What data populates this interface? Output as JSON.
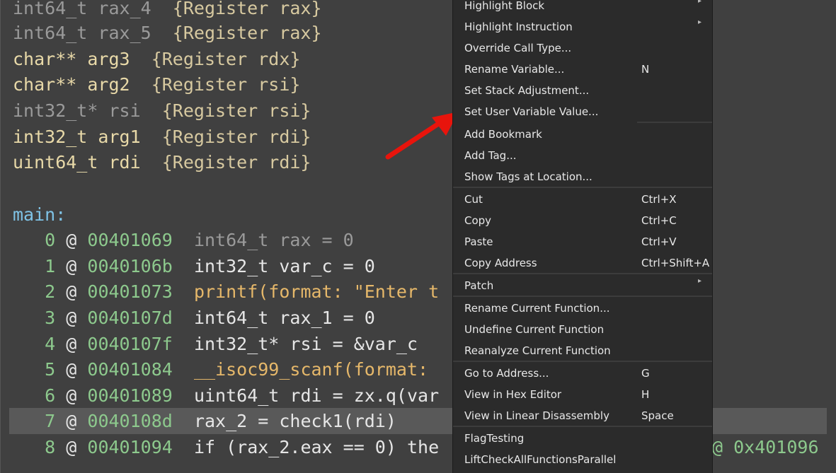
{
  "code": {
    "vars": [
      {
        "type": "int64_t",
        "name": "rax_4",
        "reg": "{Register rax}",
        "dim": true
      },
      {
        "type": "int64_t",
        "name": "rax_5",
        "reg": "{Register rax}",
        "dim": true
      },
      {
        "type": "char**",
        "name": "arg3",
        "reg": "{Register rdx}",
        "dim": false
      },
      {
        "type": "char**",
        "name": "arg2",
        "reg": "{Register rsi}",
        "dim": false
      },
      {
        "type": "int32_t*",
        "name": "rsi",
        "reg": "{Register rsi}",
        "dim": true
      },
      {
        "type": "int32_t",
        "name": "arg1",
        "reg": "{Register rdi}",
        "dim": false
      },
      {
        "type": "uint64_t",
        "name": "rdi",
        "reg": "{Register rdi}",
        "dim": false
      }
    ],
    "label": "main:",
    "lines": [
      {
        "idx": "0",
        "addr": "00401069",
        "text": "int64_t rax = 0"
      },
      {
        "idx": "1",
        "addr": "0040106b",
        "text": "int32_t var_c = 0"
      },
      {
        "idx": "2",
        "addr": "00401073",
        "text": "printf(format: \"Enter t"
      },
      {
        "idx": "3",
        "addr": "0040107d",
        "text": "int64_t rax_1 = 0"
      },
      {
        "idx": "4",
        "addr": "0040107f",
        "text": "int32_t* rsi = &var_c"
      },
      {
        "idx": "5",
        "addr": "00401084",
        "text": "__isoc99_scanf(format:"
      },
      {
        "idx": "6",
        "addr": "00401089",
        "text": "uint64_t rdi = zx.q(var"
      },
      {
        "idx": "7",
        "addr": "0040108d",
        "text": "rax_2 = check1(rdi)"
      },
      {
        "idx": "8",
        "addr": "00401094",
        "text": "if (rax_2.eax == 0) the"
      }
    ],
    "right_overflow": "@ 0x401096"
  },
  "menu": {
    "items": [
      {
        "label": "Highlight Block",
        "shortcut": "",
        "submenu": true
      },
      {
        "label": "Highlight Instruction",
        "shortcut": "",
        "submenu": true
      },
      {
        "label": "Override Call Type...",
        "shortcut": "",
        "submenu": false
      },
      {
        "label": "Rename Variable...",
        "shortcut": "N",
        "submenu": false
      },
      {
        "label": "Set Stack Adjustment...",
        "shortcut": "",
        "submenu": false
      },
      {
        "label": "Set User Variable Value...",
        "shortcut": "",
        "submenu": false
      },
      {
        "label": "Add Bookmark",
        "shortcut": "",
        "submenu": false
      },
      {
        "label": "Add Tag...",
        "shortcut": "",
        "submenu": false
      },
      {
        "label": "Show Tags at Location...",
        "shortcut": "",
        "submenu": false
      },
      {
        "label": "Cut",
        "shortcut": "Ctrl+X",
        "submenu": false
      },
      {
        "label": "Copy",
        "shortcut": "Ctrl+C",
        "submenu": false
      },
      {
        "label": "Paste",
        "shortcut": "Ctrl+V",
        "submenu": false
      },
      {
        "label": "Copy Address",
        "shortcut": "Ctrl+Shift+A",
        "submenu": false
      },
      {
        "label": "Patch",
        "shortcut": "",
        "submenu": true
      },
      {
        "label": "Rename Current Function...",
        "shortcut": "",
        "submenu": false
      },
      {
        "label": "Undefine Current Function",
        "shortcut": "",
        "submenu": false
      },
      {
        "label": "Reanalyze Current Function",
        "shortcut": "",
        "submenu": false
      },
      {
        "label": "Go to Address...",
        "shortcut": "G",
        "submenu": false
      },
      {
        "label": "View in Hex Editor",
        "shortcut": "H",
        "submenu": false
      },
      {
        "label": "View in Linear Disassembly",
        "shortcut": "Space",
        "submenu": false
      },
      {
        "label": "FlagTesting",
        "shortcut": "",
        "submenu": false
      },
      {
        "label": "LiftCheckAllFunctionsParallel",
        "shortcut": "",
        "submenu": false
      }
    ]
  },
  "colors": {
    "annotation_arrow": "#e8140c",
    "highlight_var": "#7a4a4e"
  }
}
